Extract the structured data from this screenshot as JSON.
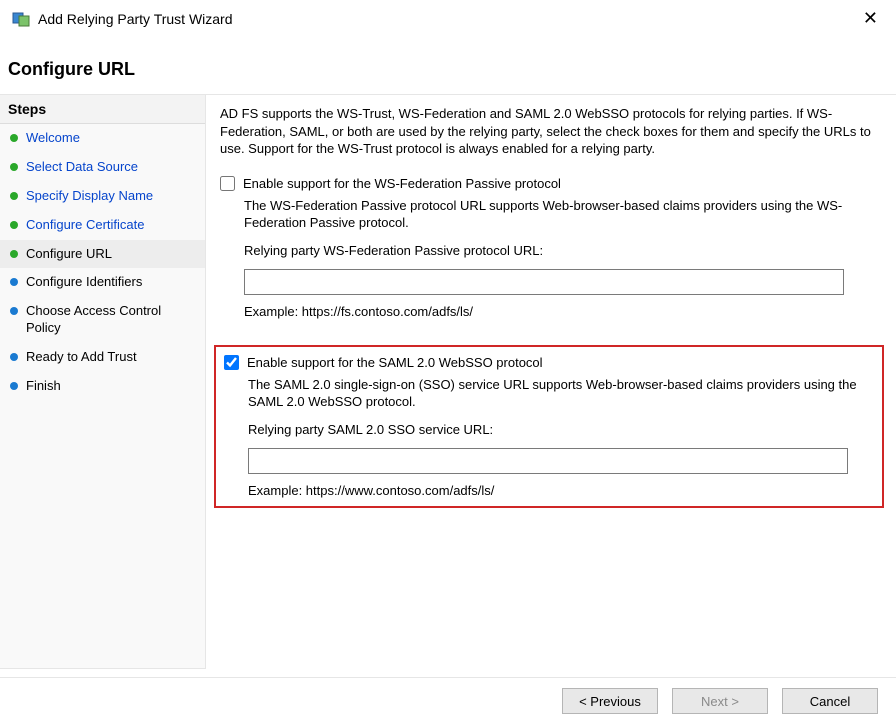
{
  "title": "Add Relying Party Trust Wizard",
  "close_glyph": "✕",
  "heading": "Configure URL",
  "sidebar": {
    "header": "Steps",
    "items": [
      {
        "label": "Welcome",
        "done": true,
        "link": true
      },
      {
        "label": "Select Data Source",
        "done": true,
        "link": true
      },
      {
        "label": "Specify Display Name",
        "done": true,
        "link": true
      },
      {
        "label": "Configure Certificate",
        "done": true,
        "link": true
      },
      {
        "label": "Configure URL",
        "done": true,
        "link": false,
        "active": true
      },
      {
        "label": "Configure Identifiers",
        "done": false,
        "link": false
      },
      {
        "label": "Choose Access Control Policy",
        "done": false,
        "link": false
      },
      {
        "label": "Ready to Add Trust",
        "done": false,
        "link": false
      },
      {
        "label": "Finish",
        "done": false,
        "link": false
      }
    ]
  },
  "content": {
    "intro": "AD FS supports the WS-Trust, WS-Federation and SAML 2.0 WebSSO protocols for relying parties.  If WS-Federation, SAML, or both are used by the relying party, select the check boxes for them and specify the URLs to use.  Support for the WS-Trust protocol is always enabled for a relying party.",
    "wsfed": {
      "checkbox_label": "Enable support for the WS-Federation Passive protocol",
      "checked": false,
      "desc": "The WS-Federation Passive protocol URL supports Web-browser-based claims providers using the WS-Federation Passive protocol.",
      "url_label": "Relying party WS-Federation Passive protocol URL:",
      "url_value": "",
      "example": "Example: https://fs.contoso.com/adfs/ls/"
    },
    "saml": {
      "checkbox_label": "Enable support for the SAML 2.0 WebSSO protocol",
      "checked": true,
      "desc": "The SAML 2.0 single-sign-on (SSO) service URL supports Web-browser-based claims providers using the SAML 2.0 WebSSO protocol.",
      "url_label": "Relying party SAML 2.0 SSO service URL:",
      "url_value": "",
      "example": "Example: https://www.contoso.com/adfs/ls/"
    }
  },
  "buttons": {
    "previous": "< Previous",
    "next": "Next >",
    "cancel": "Cancel"
  }
}
